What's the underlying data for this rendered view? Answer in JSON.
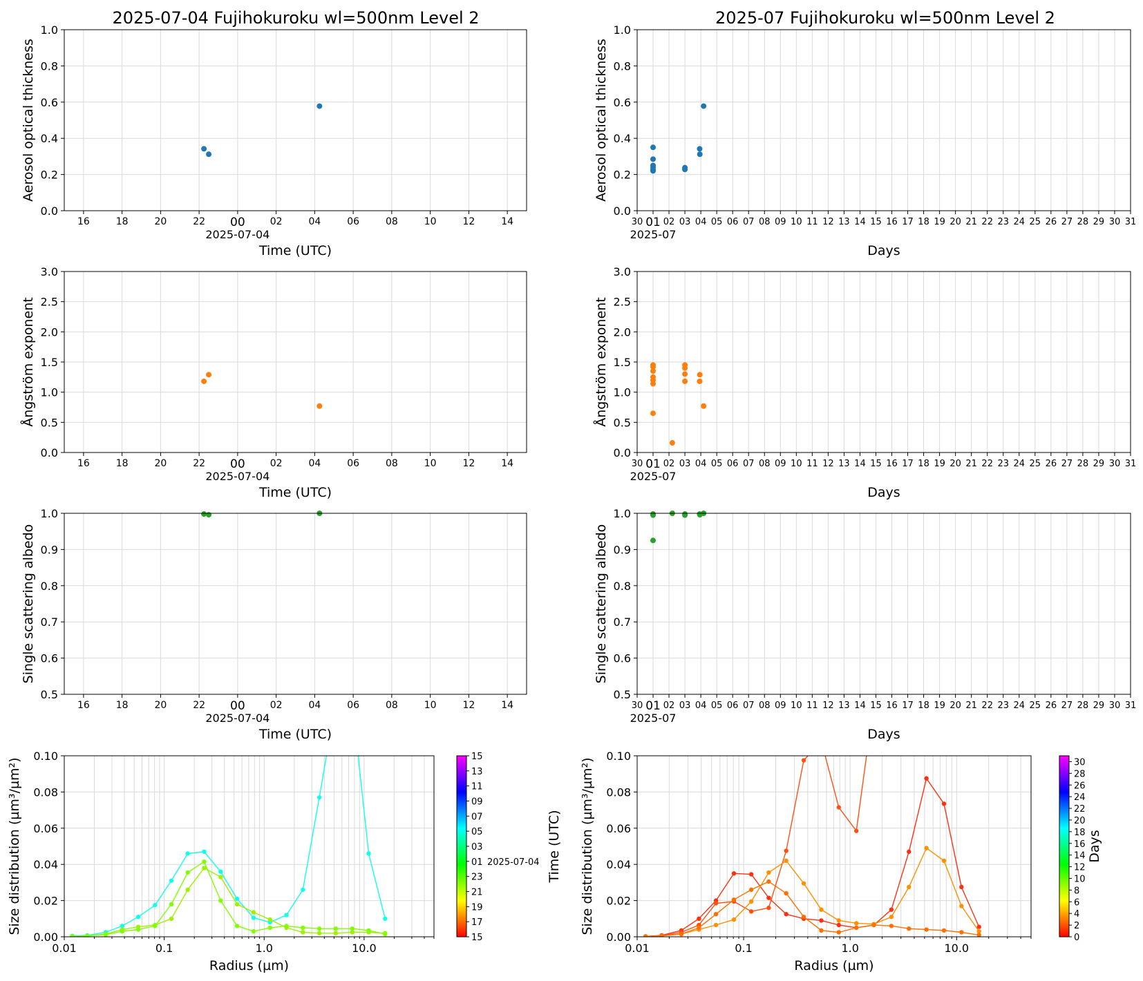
{
  "figure": {
    "left_title": "2025-07-04  Fujihokuroku  wl=500nm  Level 2",
    "right_title": "2025-07  Fujihokuroku  wl=500nm  Level 2"
  },
  "colors": {
    "aod": "#1f77b4",
    "angstrom": "#ff7f0e",
    "ssa": "#2ca02c",
    "grid": "#d9d9d9"
  },
  "chart_data": [
    {
      "id": "daily-aod",
      "type": "scatter",
      "xlabel": "Time (UTC)",
      "ylabel": "Aerosol optical thickness",
      "xlim": [
        "2025-07-03 15:00",
        "2025-07-04 15:00"
      ],
      "ylim": [
        0,
        1.0
      ],
      "yticks": [
        "0.0",
        "0.2",
        "0.4",
        "0.6",
        "0.8",
        "1.0"
      ],
      "xticks": [
        "16",
        "18",
        "20",
        "22",
        "00",
        "02",
        "04",
        "06",
        "08",
        "10",
        "12",
        "14"
      ],
      "xdate_label": "2025-07-04",
      "grid": true,
      "points": [
        {
          "x": "2025-07-03 22:15",
          "y": 0.342
        },
        {
          "x": "2025-07-03 22:30",
          "y": 0.312
        },
        {
          "x": "2025-07-04 04:15",
          "y": 0.578
        }
      ]
    },
    {
      "id": "monthly-aod",
      "type": "scatter",
      "xlabel": "Days",
      "ylabel": "Aerosol optical thickness",
      "xlim": [
        "2025-06-30",
        "2025-07-31"
      ],
      "ylim": [
        0,
        1.0
      ],
      "yticks": [
        "0.0",
        "0.2",
        "0.4",
        "0.6",
        "0.8",
        "1.0"
      ],
      "xticks": [
        "30",
        "01",
        "02",
        "03",
        "04",
        "05",
        "06",
        "07",
        "08",
        "09",
        "10",
        "11",
        "12",
        "13",
        "14",
        "15",
        "16",
        "17",
        "18",
        "19",
        "20",
        "21",
        "22",
        "23",
        "24",
        "25",
        "26",
        "27",
        "28",
        "29",
        "30",
        "31"
      ],
      "xdate_label": "2025-07",
      "grid": true,
      "points": [
        {
          "x": "2025-07-01 00:00",
          "y": 0.35
        },
        {
          "x": "2025-07-01 00:00",
          "y": 0.285
        },
        {
          "x": "2025-07-01 00:00",
          "y": 0.25
        },
        {
          "x": "2025-07-01 00:00",
          "y": 0.24
        },
        {
          "x": "2025-07-01 00:00",
          "y": 0.228
        },
        {
          "x": "2025-07-01 00:00",
          "y": 0.22
        },
        {
          "x": "2025-07-03 00:00",
          "y": 0.238
        },
        {
          "x": "2025-07-03 00:00",
          "y": 0.232
        },
        {
          "x": "2025-07-03 00:00",
          "y": 0.228
        },
        {
          "x": "2025-07-03 22:15",
          "y": 0.342
        },
        {
          "x": "2025-07-03 22:30",
          "y": 0.312
        },
        {
          "x": "2025-07-04 04:15",
          "y": 0.578
        }
      ]
    },
    {
      "id": "daily-angstrom",
      "type": "scatter",
      "xlabel": "Time (UTC)",
      "ylabel": "Ångström exponent",
      "xlim": [
        "2025-07-03 15:00",
        "2025-07-04 15:00"
      ],
      "ylim": [
        0,
        3.0
      ],
      "yticks": [
        "0.0",
        "0.5",
        "1.0",
        "1.5",
        "2.0",
        "2.5",
        "3.0"
      ],
      "xticks": [
        "16",
        "18",
        "20",
        "22",
        "00",
        "02",
        "04",
        "06",
        "08",
        "10",
        "12",
        "14"
      ],
      "xdate_label": "2025-07-04",
      "grid": true,
      "points": [
        {
          "x": "2025-07-03 22:15",
          "y": 1.18
        },
        {
          "x": "2025-07-03 22:30",
          "y": 1.29
        },
        {
          "x": "2025-07-04 04:15",
          "y": 0.77
        }
      ]
    },
    {
      "id": "monthly-angstrom",
      "type": "scatter",
      "xlabel": "Days",
      "ylabel": "Ångström exponent",
      "xlim": [
        "2025-06-30",
        "2025-07-31"
      ],
      "ylim": [
        0,
        3.0
      ],
      "yticks": [
        "0.0",
        "0.5",
        "1.0",
        "1.5",
        "2.0",
        "2.5",
        "3.0"
      ],
      "xticks": [
        "30",
        "01",
        "02",
        "03",
        "04",
        "05",
        "06",
        "07",
        "08",
        "09",
        "10",
        "11",
        "12",
        "13",
        "14",
        "15",
        "16",
        "17",
        "18",
        "19",
        "20",
        "21",
        "22",
        "23",
        "24",
        "25",
        "26",
        "27",
        "28",
        "29",
        "30",
        "31"
      ],
      "xdate_label": "2025-07",
      "grid": true,
      "points": [
        {
          "x": "2025-07-01 00:00",
          "y": 1.45
        },
        {
          "x": "2025-07-01 00:00",
          "y": 1.42
        },
        {
          "x": "2025-07-01 00:00",
          "y": 1.35
        },
        {
          "x": "2025-07-01 00:00",
          "y": 1.25
        },
        {
          "x": "2025-07-01 00:00",
          "y": 1.2
        },
        {
          "x": "2025-07-01 00:00",
          "y": 1.14
        },
        {
          "x": "2025-07-01 00:00",
          "y": 0.65
        },
        {
          "x": "2025-07-02 05:00",
          "y": 0.16
        },
        {
          "x": "2025-07-03 00:00",
          "y": 1.45
        },
        {
          "x": "2025-07-03 00:00",
          "y": 1.4
        },
        {
          "x": "2025-07-03 00:00",
          "y": 1.3
        },
        {
          "x": "2025-07-03 00:00",
          "y": 1.18
        },
        {
          "x": "2025-07-03 22:15",
          "y": 1.18
        },
        {
          "x": "2025-07-03 22:30",
          "y": 1.29
        },
        {
          "x": "2025-07-04 04:15",
          "y": 0.77
        }
      ]
    },
    {
      "id": "daily-ssa",
      "type": "scatter",
      "xlabel": "Time (UTC)",
      "ylabel": "Single scattering albedo",
      "xlim": [
        "2025-07-03 15:00",
        "2025-07-04 15:00"
      ],
      "ylim": [
        0.5,
        1.0
      ],
      "yticks": [
        "0.5",
        "0.6",
        "0.7",
        "0.8",
        "0.9",
        "1.0"
      ],
      "xticks": [
        "16",
        "18",
        "20",
        "22",
        "00",
        "02",
        "04",
        "06",
        "08",
        "10",
        "12",
        "14"
      ],
      "xdate_label": "2025-07-04",
      "grid": true,
      "points": [
        {
          "x": "2025-07-03 22:15",
          "y": 0.998
        },
        {
          "x": "2025-07-03 22:30",
          "y": 0.996
        },
        {
          "x": "2025-07-04 04:15",
          "y": 1.0
        }
      ]
    },
    {
      "id": "monthly-ssa",
      "type": "scatter",
      "xlabel": "Days",
      "ylabel": "Single scattering albedo",
      "xlim": [
        "2025-06-30",
        "2025-07-31"
      ],
      "ylim": [
        0.5,
        1.0
      ],
      "yticks": [
        "0.5",
        "0.6",
        "0.7",
        "0.8",
        "0.9",
        "1.0"
      ],
      "xticks": [
        "30",
        "01",
        "02",
        "03",
        "04",
        "05",
        "06",
        "07",
        "08",
        "09",
        "10",
        "11",
        "12",
        "13",
        "14",
        "15",
        "16",
        "17",
        "18",
        "19",
        "20",
        "21",
        "22",
        "23",
        "24",
        "25",
        "26",
        "27",
        "28",
        "29",
        "30",
        "31"
      ],
      "xdate_label": "2025-07",
      "grid": true,
      "points": [
        {
          "x": "2025-07-01 00:00",
          "y": 0.998
        },
        {
          "x": "2025-07-01 00:00",
          "y": 0.995
        },
        {
          "x": "2025-07-01 00:00",
          "y": 0.925
        },
        {
          "x": "2025-07-02 05:00",
          "y": 1.0
        },
        {
          "x": "2025-07-03 00:00",
          "y": 0.998
        },
        {
          "x": "2025-07-03 00:00",
          "y": 0.995
        },
        {
          "x": "2025-07-03 22:15",
          "y": 0.998
        },
        {
          "x": "2025-07-03 22:30",
          "y": 0.996
        },
        {
          "x": "2025-07-04 04:15",
          "y": 1.0
        }
      ]
    },
    {
      "id": "daily-size-distribution",
      "type": "line",
      "xlabel": "Radius (µm)",
      "ylabel": "Size distribution (µm³/µm²)",
      "xscale": "log",
      "xlim": [
        0.01,
        50
      ],
      "ylim": [
        0,
        0.1
      ],
      "xticks": [
        "0.01",
        "0.1",
        "1.0",
        "10.0"
      ],
      "yticks": [
        "0.00",
        "0.02",
        "0.04",
        "0.06",
        "0.08",
        "0.10"
      ],
      "grid": true,
      "x": [
        0.012,
        0.017,
        0.026,
        0.038,
        0.055,
        0.081,
        0.118,
        0.172,
        0.251,
        0.367,
        0.536,
        0.783,
        1.144,
        1.671,
        2.44,
        3.565,
        5.207,
        7.606,
        11.11,
        16.228
      ],
      "series": [
        {
          "time": "2025-07-04 04:15",
          "color": "#10ffe8",
          "values": [
            0.0005,
            0.0008,
            0.0025,
            0.006,
            0.011,
            0.0175,
            0.031,
            0.046,
            0.047,
            0.036,
            0.021,
            0.0105,
            0.008,
            0.012,
            0.026,
            0.077,
            0.13,
            0.13,
            0.046,
            0.01
          ]
        },
        {
          "time": "2025-07-03 22:15",
          "color": "#a0f000",
          "values": [
            0.0002,
            0.0005,
            0.0015,
            0.004,
            0.0055,
            0.0065,
            0.01,
            0.026,
            0.038,
            0.033,
            0.018,
            0.0135,
            0.0095,
            0.005,
            0.0025,
            0.002,
            0.002,
            0.0025,
            0.0025,
            0.002
          ]
        },
        {
          "time": "2025-07-03 22:30",
          "color": "#80ff00",
          "values": [
            0.0002,
            0.0005,
            0.0012,
            0.003,
            0.004,
            0.006,
            0.018,
            0.0355,
            0.0415,
            0.02,
            0.006,
            0.003,
            0.005,
            0.006,
            0.005,
            0.0045,
            0.0045,
            0.0045,
            0.0035,
            0.0015
          ]
        }
      ],
      "colorbar": {
        "label": "Time (UTC)",
        "ticks": [
          "15",
          "17",
          "19",
          "21",
          "23",
          "01",
          "03",
          "05",
          "07",
          "09",
          "11",
          "13",
          "15"
        ],
        "date_label": "2025-07-04",
        "min": 0,
        "max": 24
      }
    },
    {
      "id": "monthly-size-distribution",
      "type": "line",
      "xlabel": "Radius (µm)",
      "ylabel": "Size distribution (µm³/µm²)",
      "xscale": "log",
      "xlim": [
        0.01,
        50
      ],
      "ylim": [
        0,
        0.1
      ],
      "xticks": [
        "0.01",
        "0.1",
        "1.0",
        "10.0"
      ],
      "yticks": [
        "0.00",
        "0.02",
        "0.04",
        "0.06",
        "0.08",
        "0.10"
      ],
      "grid": true,
      "x": [
        0.012,
        0.017,
        0.026,
        0.038,
        0.055,
        0.081,
        0.118,
        0.172,
        0.251,
        0.367,
        0.536,
        0.783,
        1.144,
        1.671,
        2.44,
        3.565,
        5.207,
        7.606,
        11.11,
        16.228
      ],
      "series": [
        {
          "day": "2025-07-01",
          "color": "#ff3010",
          "values": [
            0.0002,
            0.0008,
            0.0035,
            0.01,
            0.02,
            0.035,
            0.0345,
            0.0215,
            0.0125,
            0.01,
            0.009,
            0.0065,
            0.005,
            0.0065,
            0.015,
            0.047,
            0.0875,
            0.0735,
            0.0275,
            0.0055
          ]
        },
        {
          "day": "2025-07-02",
          "color": "#ff5010",
          "values": [
            0.0002,
            0.0005,
            0.0025,
            0.0065,
            0.0185,
            0.0195,
            0.014,
            0.016,
            0.0475,
            0.0975,
            0.108,
            0.0715,
            0.0585,
            0.13,
            0.13,
            0.13,
            0.13,
            0.13,
            0.13,
            0.13
          ]
        },
        {
          "day": "2025-07-03",
          "color": "#ff9000",
          "values": [
            0.0002,
            0.0005,
            0.0015,
            0.004,
            0.0065,
            0.0095,
            0.0195,
            0.0355,
            0.042,
            0.0295,
            0.015,
            0.009,
            0.0075,
            0.007,
            0.011,
            0.0275,
            0.049,
            0.042,
            0.017,
            0.003
          ]
        },
        {
          "day": "2025-07-04",
          "color": "#ff7000",
          "values": [
            0.0002,
            0.0005,
            0.0015,
            0.005,
            0.0125,
            0.0205,
            0.026,
            0.0305,
            0.024,
            0.011,
            0.0035,
            0.0025,
            0.005,
            0.0065,
            0.006,
            0.0045,
            0.004,
            0.0035,
            0.0025,
            0.001
          ]
        }
      ],
      "colorbar": {
        "label": "Days",
        "ticks": [
          "0",
          "2",
          "4",
          "6",
          "8",
          "10",
          "12",
          "14",
          "16",
          "18",
          "20",
          "22",
          "24",
          "26",
          "28",
          "30"
        ],
        "min": 0,
        "max": 31
      }
    }
  ]
}
